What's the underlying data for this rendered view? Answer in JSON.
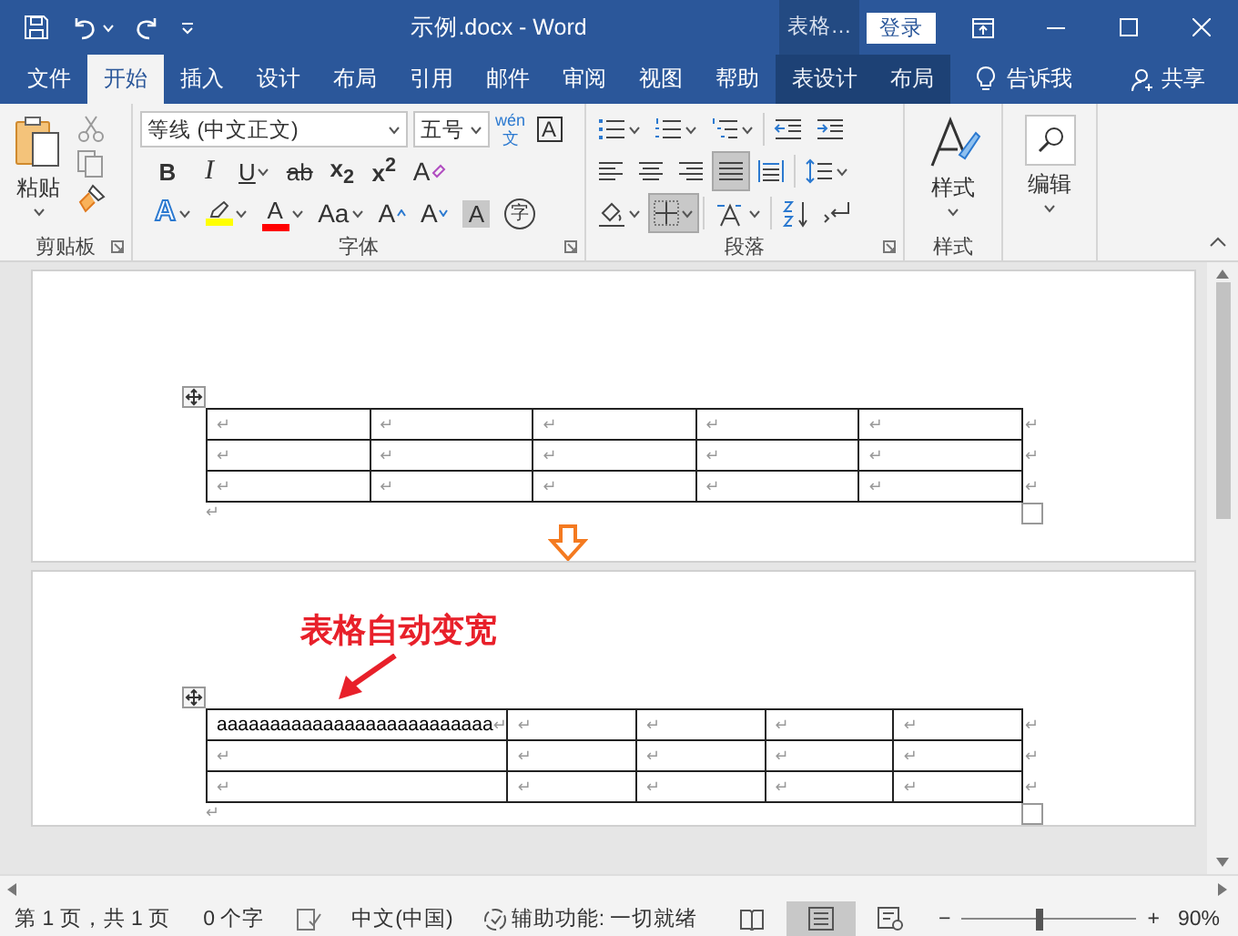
{
  "window": {
    "title": "示例.docx - Word",
    "context_header": "表格…",
    "sign_in": "登录"
  },
  "quick_access": [
    {
      "kind": "save"
    },
    {
      "kind": "undo",
      "dropdown": true
    },
    {
      "kind": "redo"
    },
    {
      "kind": "customize"
    }
  ],
  "tabs": [
    {
      "label": "文件",
      "selected": false,
      "contextual": false
    },
    {
      "label": "开始",
      "selected": true,
      "contextual": false
    },
    {
      "label": "插入",
      "selected": false,
      "contextual": false
    },
    {
      "label": "设计",
      "selected": false,
      "contextual": false
    },
    {
      "label": "布局",
      "selected": false,
      "contextual": false
    },
    {
      "label": "引用",
      "selected": false,
      "contextual": false
    },
    {
      "label": "邮件",
      "selected": false,
      "contextual": false
    },
    {
      "label": "审阅",
      "selected": false,
      "contextual": false
    },
    {
      "label": "视图",
      "selected": false,
      "contextual": false
    },
    {
      "label": "帮助",
      "selected": false,
      "contextual": false
    },
    {
      "label": "表设计",
      "selected": false,
      "contextual": true
    },
    {
      "label": "布局",
      "selected": false,
      "contextual": true
    }
  ],
  "tell_me": "告诉我",
  "share": "共享",
  "ribbon": {
    "clipboard": {
      "paste": "粘贴",
      "label": "剪贴板"
    },
    "font": {
      "face": "等线 (中文正文)",
      "size": "五号",
      "phonetic": {
        "top": "wén",
        "bottom": "文"
      },
      "border_char": "A",
      "label": "字体",
      "row2": [
        {
          "kind": "bold",
          "text": "B"
        },
        {
          "kind": "italic",
          "text": "I"
        },
        {
          "kind": "underline",
          "text": "U",
          "dropdown": true
        },
        {
          "kind": "strike",
          "text": "ab"
        },
        {
          "kind": "subscript",
          "text": "x$_{2}$"
        },
        {
          "kind": "superscript",
          "text": "x$^{2}$"
        },
        {
          "kind": "clear",
          "text": "A"
        }
      ],
      "row3": [
        {
          "kind": "effects",
          "text": "A",
          "dropdown": true
        },
        {
          "kind": "highlight",
          "dropdown": true,
          "color": "#ffff00"
        },
        {
          "kind": "font_color",
          "text": "A",
          "dropdown": true,
          "color": "#ff0000"
        },
        {
          "kind": "case",
          "text": "Aa",
          "dropdown": true
        },
        {
          "kind": "grow",
          "text": "A"
        },
        {
          "kind": "shrink",
          "text": "A"
        },
        {
          "kind": "shading",
          "text": "A"
        },
        {
          "kind": "enclose",
          "text": "字"
        }
      ]
    },
    "paragraph": {
      "label": "段落",
      "rows": [
        [
          {
            "kind": "bullets",
            "dropdown": true
          },
          {
            "kind": "numbering",
            "dropdown": true
          },
          {
            "kind": "multilevel",
            "dropdown": true
          },
          {
            "kind": "separator"
          },
          {
            "kind": "outdent"
          },
          {
            "kind": "indent"
          }
        ],
        [
          {
            "kind": "align_left",
            "selected": false
          },
          {
            "kind": "align_center",
            "selected": false
          },
          {
            "kind": "align_right",
            "selected": false
          },
          {
            "kind": "justify",
            "selected": true
          },
          {
            "kind": "distribute",
            "selected": false
          },
          {
            "kind": "separator"
          },
          {
            "kind": "line_spacing",
            "dropdown": true,
            "selected": false
          }
        ],
        [
          {
            "kind": "shading",
            "dropdown": true,
            "selected": false
          },
          {
            "kind": "borders",
            "dropdown": true,
            "selected": true
          },
          {
            "kind": "separator"
          },
          {
            "kind": "asian_layout",
            "dropdown": true,
            "selected": false
          },
          {
            "kind": "separator"
          },
          {
            "kind": "sort",
            "selected": false
          },
          {
            "kind": "show_marks",
            "selected": false
          }
        ]
      ]
    },
    "styles": {
      "button": "样式",
      "label": "样式"
    },
    "editing": {
      "button": "编辑"
    }
  },
  "document": {
    "pages": [
      {
        "down_arrow": true,
        "after": "↵",
        "table": {
          "rows": [
            {
              "cells": [
                {
                  "mark": "↵"
                },
                {
                  "mark": "↵"
                },
                {
                  "mark": "↵"
                },
                {
                  "mark": "↵"
                },
                {
                  "mark": "↵"
                }
              ],
              "end": "↵"
            },
            {
              "cells": [
                {
                  "mark": "↵"
                },
                {
                  "mark": "↵"
                },
                {
                  "mark": "↵"
                },
                {
                  "mark": "↵"
                },
                {
                  "mark": "↵"
                }
              ],
              "end": "↵"
            },
            {
              "cells": [
                {
                  "mark": "↵"
                },
                {
                  "mark": "↵"
                },
                {
                  "mark": "↵"
                },
                {
                  "mark": "↵"
                },
                {
                  "mark": "↵"
                }
              ],
              "end": "↵"
            }
          ]
        }
      },
      {
        "annotation": "表格自动变宽",
        "after": "↵",
        "table": {
          "rows": [
            {
              "cells": [
                {
                  "text": "aaaaaaaaaaaaaaaaaaaaaaaaaa",
                  "mark": "↵"
                },
                {
                  "mark": "↵"
                },
                {
                  "mark": "↵"
                },
                {
                  "mark": "↵"
                },
                {
                  "mark": "↵"
                }
              ],
              "end": "↵"
            },
            {
              "cells": [
                {
                  "mark": "↵"
                },
                {
                  "mark": "↵"
                },
                {
                  "mark": "↵"
                },
                {
                  "mark": "↵"
                },
                {
                  "mark": "↵"
                }
              ],
              "end": "↵"
            },
            {
              "cells": [
                {
                  "mark": "↵"
                },
                {
                  "mark": "↵"
                },
                {
                  "mark": "↵"
                },
                {
                  "mark": "↵"
                },
                {
                  "mark": "↵"
                }
              ],
              "end": "↵"
            }
          ]
        }
      }
    ]
  },
  "status_bar": {
    "page": "第 1 页，共 1 页",
    "words": "0 个字",
    "language": "中文(中国)",
    "accessibility": "辅助功能: 一切就绪",
    "views": [
      {
        "kind": "read",
        "selected": false
      },
      {
        "kind": "print",
        "selected": true
      },
      {
        "kind": "web",
        "selected": false
      }
    ],
    "zoom": {
      "minus": "−",
      "plus": "+",
      "level": 0.45,
      "value": "90%"
    }
  }
}
